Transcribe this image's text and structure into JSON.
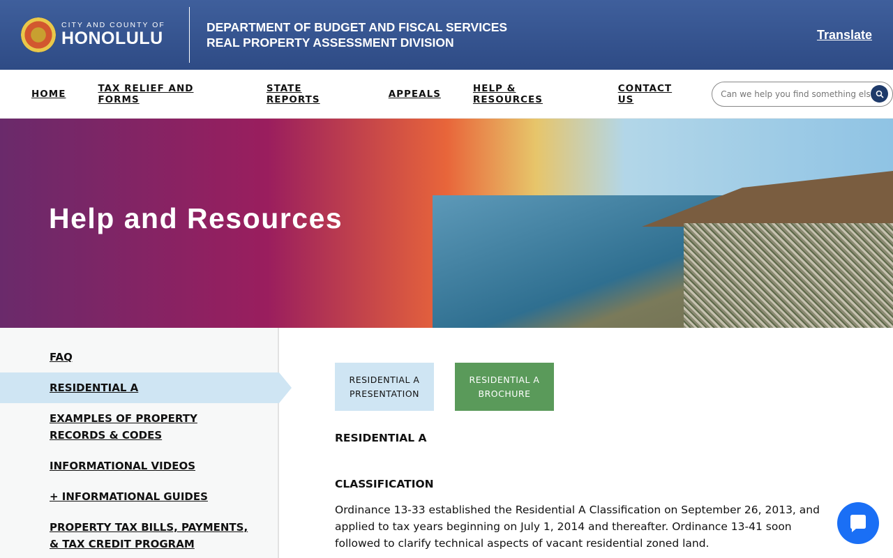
{
  "header": {
    "city_line1": "CITY AND COUNTY OF",
    "city_line2": "HONOLULU",
    "dept_line1": "DEPARTMENT OF BUDGET AND FISCAL SERVICES",
    "dept_line2": "REAL PROPERTY ASSESSMENT DIVISION",
    "translate": "Translate"
  },
  "nav": {
    "items": [
      "HOME",
      "TAX RELIEF AND FORMS",
      "STATE REPORTS",
      "APPEALS",
      "HELP & RESOURCES",
      "CONTACT US"
    ],
    "search_placeholder": "Can we help you find something else?"
  },
  "hero": {
    "title": "Help and Resources"
  },
  "sidebar": {
    "items": [
      "FAQ",
      "RESIDENTIAL A",
      "EXAMPLES OF PROPERTY RECORDS & CODES",
      "INFORMATIONAL VIDEOS",
      "+ INFORMATIONAL GUIDES",
      "PROPERTY TAX BILLS, PAYMENTS, & TAX CREDIT PROGRAM"
    ],
    "active": "RESIDENTIAL A"
  },
  "content": {
    "button1": "RESIDENTIAL A PRESENTATION",
    "button2": "RESIDENTIAL A BROCHURE",
    "heading": "RESIDENTIAL A",
    "subheading": "CLASSIFICATION",
    "paragraph": "Ordinance 13-33 established the Residential A Classification on September 26, 2013, and applied to tax years beginning on July 1, 2014 and thereafter. Ordinance 13-41 soon followed to clarify technical aspects of vacant residential zoned land."
  },
  "colors": {
    "header": "#34528e",
    "search_button": "#1e3a6a",
    "active_item": "#cfe5f3",
    "brochure_button": "#5a9a5a",
    "chat": "#1a6ff5"
  }
}
